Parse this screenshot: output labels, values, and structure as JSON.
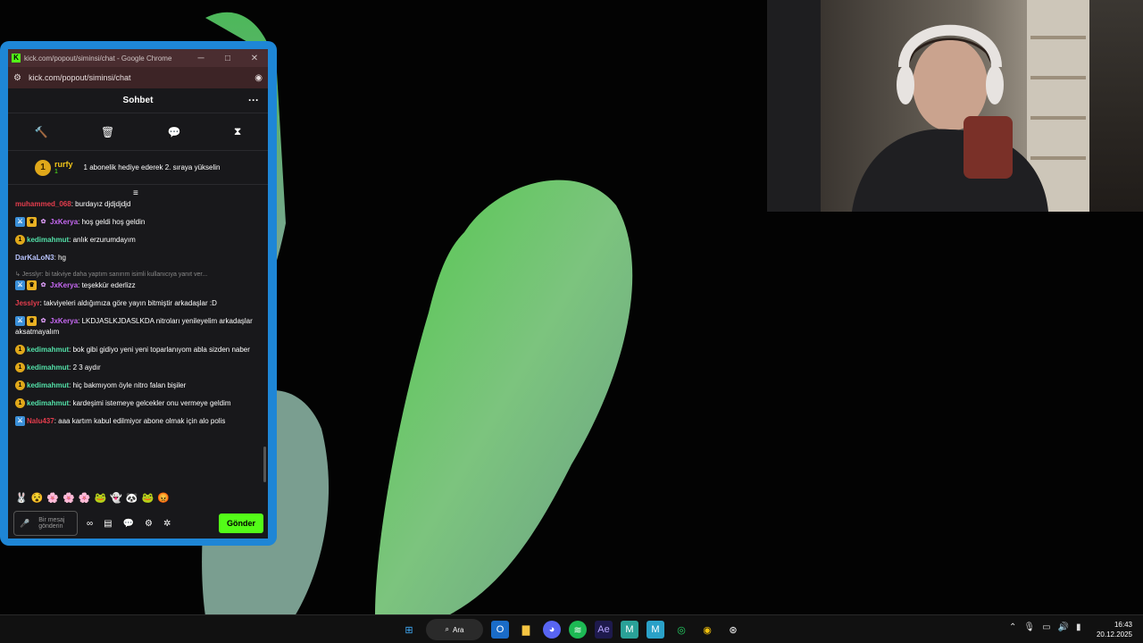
{
  "browser": {
    "title": "kick.com/popout/siminsi/chat - Google Chrome",
    "url": "kick.com/popout/siminsi/chat",
    "minimize": "─",
    "maximize": "□",
    "close": "✕"
  },
  "chat": {
    "header": "Sohbet",
    "more": "···",
    "pinned": {
      "rank": "1",
      "user": "rurfy",
      "count": "1",
      "gift_text": "1 abonelik hediye ederek 2. sıraya yükselin"
    },
    "messages": [
      {
        "name": "muhammed_068",
        "color": "#e53d4d",
        "text": ": burdayız djdjdjdjd",
        "badges": []
      },
      {
        "name": "JxKerya",
        "color": "#c668f2",
        "text": ": hoş geldi hoş geldin",
        "badges": [
          "mod",
          "vip",
          "gift"
        ]
      },
      {
        "name": "kedimahmut",
        "color": "#53e0a8",
        "text": ": anlık erzurumdayım",
        "badges": [
          "sub"
        ]
      },
      {
        "name": "DarKaLoN3",
        "color": "#b9c4ff",
        "text": ": hg",
        "badges": []
      },
      {
        "reply": "Jesslyr: bi takviye daha yaptım sanırım isimli kullanıcıya yanıt ver...",
        "name": "JxKerya",
        "color": "#c668f2",
        "text": ": teşekkür ederlizz",
        "badges": [
          "mod",
          "vip",
          "gift"
        ]
      },
      {
        "name": "Jesslyr",
        "color": "#e53d4d",
        "text": ": takviyeleri aldığımıza göre yayın bitmiştir arkadaşlar :D",
        "badges": []
      },
      {
        "name": "JxKerya",
        "color": "#c668f2",
        "text": ": LKDJASLKJDASLKDA nitroları yenileyelim arkadaşlar aksatmayalım",
        "badges": [
          "mod",
          "vip",
          "gift"
        ]
      },
      {
        "name": "kedimahmut",
        "color": "#53e0a8",
        "text": ": bok gibi gidiyo yeni yeni toparlanıyom abla sizden naber",
        "badges": [
          "sub"
        ]
      },
      {
        "name": "kedimahmut",
        "color": "#53e0a8",
        "text": ": 2 3 aydır",
        "badges": [
          "sub"
        ]
      },
      {
        "name": "kedimahmut",
        "color": "#53e0a8",
        "text": ": hiç bakmıyom öyle nitro falan bişiler",
        "badges": [
          "sub"
        ]
      },
      {
        "name": "kedimahmut",
        "color": "#53e0a8",
        "text": ": kardeşimi istemeye gelcekler onu vermeye geldim",
        "badges": [
          "sub"
        ]
      },
      {
        "name": "Nalu437",
        "color": "#e53d4d",
        "text": ": aaa kartım kabul edilmiyor abone olmak için alo polis",
        "badges": [
          "mod"
        ]
      }
    ],
    "emotes": [
      "🐰",
      "😵",
      "🌸",
      "🌸",
      "🌸",
      "🐸",
      "👻",
      "🐼",
      "🐸",
      "😡"
    ],
    "input_placeholder": "Bir mesaj gönderin",
    "send_label": "Gönder"
  },
  "taskbar": {
    "search_label": "Ara",
    "time": "16:43",
    "date": "20.12.2025"
  }
}
